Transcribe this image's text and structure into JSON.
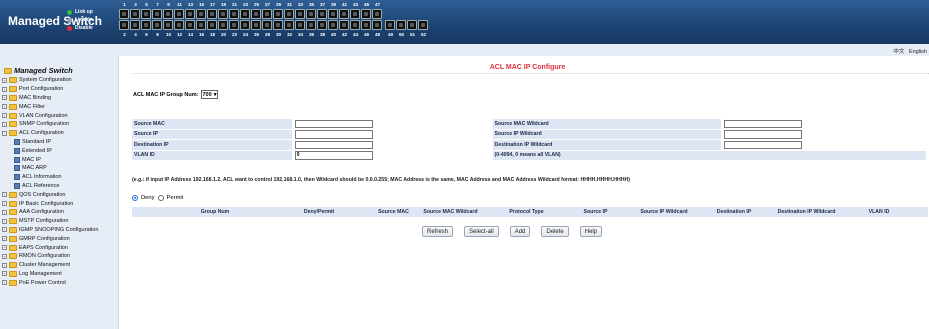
{
  "header": {
    "brand": "Managed Switch",
    "legend": [
      {
        "label": "Link up",
        "color": "#2ec24a"
      },
      {
        "label": "Link dn",
        "color": "#9aa4b0"
      },
      {
        "label": "Disable",
        "color": "#e02d2d"
      }
    ],
    "ports_top": [
      "1",
      "3",
      "5",
      "7",
      "9",
      "11",
      "13",
      "15",
      "17",
      "19",
      "21",
      "23",
      "25",
      "27",
      "29",
      "31",
      "33",
      "35",
      "37",
      "39",
      "41",
      "43",
      "45",
      "47"
    ],
    "ports_bottom": [
      "2",
      "4",
      "6",
      "8",
      "10",
      "12",
      "14",
      "16",
      "18",
      "20",
      "22",
      "24",
      "26",
      "28",
      "30",
      "32",
      "34",
      "36",
      "38",
      "40",
      "42",
      "44",
      "46",
      "48"
    ],
    "sfp_bottom": [
      "49",
      "50",
      "51",
      "52"
    ]
  },
  "lang": {
    "zh": "中文",
    "en": "English"
  },
  "sidebar": {
    "title": "Managed Switch",
    "items": [
      {
        "label": "System Configuration",
        "level": 0
      },
      {
        "label": "Port Configuration",
        "level": 0
      },
      {
        "label": "MAC Binding",
        "level": 0
      },
      {
        "label": "MAC Filter",
        "level": 0
      },
      {
        "label": "VLAN Configuration",
        "level": 0
      },
      {
        "label": "SNMP Configuration",
        "level": 0
      },
      {
        "label": "ACL Configuration",
        "level": 0,
        "expanded": true
      },
      {
        "label": "Standard IP",
        "level": 1
      },
      {
        "label": "Extended IP",
        "level": 1
      },
      {
        "label": "MAC IP",
        "level": 1
      },
      {
        "label": "MAC ARP",
        "level": 1
      },
      {
        "label": "ACL Information",
        "level": 1
      },
      {
        "label": "ACL Reference",
        "level": 1
      },
      {
        "label": "QOS Configuration",
        "level": 0
      },
      {
        "label": "IP Basic Configuration",
        "level": 0
      },
      {
        "label": "AAA Configuration",
        "level": 0
      },
      {
        "label": "MSTP Configuration",
        "level": 0
      },
      {
        "label": "IGMP SNOOPING Configuration",
        "level": 0
      },
      {
        "label": "GMRP Configuration",
        "level": 0
      },
      {
        "label": "EAPS Configuration",
        "level": 0
      },
      {
        "label": "RMON Configuration",
        "level": 0
      },
      {
        "label": "Cluster Management",
        "level": 0
      },
      {
        "label": "Log Management",
        "level": 0
      },
      {
        "label": "PoE Power Control",
        "level": 0
      }
    ]
  },
  "main": {
    "title": "ACL MAC IP Configure",
    "group_label": "ACL MAC IP Group Num:",
    "group_value": "700",
    "form": {
      "source_mac": "Source MAC",
      "source_mac_wildcard": "Source MAC Wildcard",
      "source_ip": "Source IP",
      "source_ip_wildcard": "Source IP Wildcard",
      "destination_ip": "Destination IP",
      "destination_ip_wildcard": "Destination IP Wildcard",
      "vlan_id": "VLAN ID",
      "vlan_value": "0",
      "vlan_hint": "(0-4094, 0 means all VLAN)"
    },
    "example": "(e.g.: if input IP Address 192.168.1.2, ACL want to control 192.168.1.0, then Wildcard should be 0.0.0.255; MAC Address is the same, MAC Address and MAC Address Wildcard format: HHHH.HHHH.HHHH)",
    "deny_label": "Deny",
    "permit_label": "Permit",
    "columns": [
      {
        "label": "",
        "w": 31
      },
      {
        "label": "Group Num",
        "w": 104
      },
      {
        "label": "Deny/Permit",
        "w": 104
      },
      {
        "label": "Source MAC",
        "w": 45
      },
      {
        "label": "Source MAC Wildcard",
        "w": 69
      },
      {
        "label": "Protocol Type",
        "w": 83
      },
      {
        "label": "Source IP",
        "w": 55
      },
      {
        "label": "Source IP Wildcard",
        "w": 82
      },
      {
        "label": "Destination IP",
        "w": 58
      },
      {
        "label": "Destination IP Wildcard",
        "w": 87
      },
      {
        "label": "VLAN ID",
        "w": 58
      }
    ],
    "buttons": {
      "refresh": "Refresh",
      "select_all": "Select-all",
      "add": "Add",
      "delete": "Delete",
      "help": "Help"
    }
  }
}
